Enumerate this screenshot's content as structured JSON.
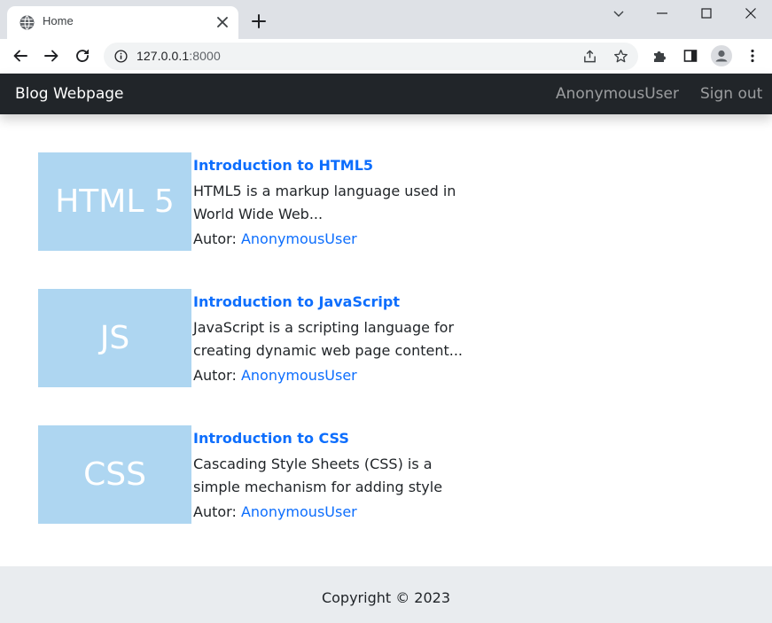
{
  "browser": {
    "tab_title": "Home",
    "url_host": "127.0.0.1",
    "url_port": ":8000"
  },
  "navbar": {
    "brand": "Blog Webpage",
    "user": "AnonymousUser",
    "sign_out": "Sign out"
  },
  "posts": [
    {
      "thumb_text": "HTML 5",
      "title": "Introduction to HTML5",
      "excerpt": "HTML5 is a markup language used in World Wide Web...",
      "author_label": "Autor:",
      "author": "AnonymousUser"
    },
    {
      "thumb_text": "JS",
      "title": "Introduction to JavaScript",
      "excerpt": "JavaScript is a scripting language for creating dynamic web page content...",
      "author_label": "Autor:",
      "author": "AnonymousUser"
    },
    {
      "thumb_text": "CSS",
      "title": "Introduction to CSS",
      "excerpt": "Cascading Style Sheets (CSS) is a simple mechanism for adding style",
      "author_label": "Autor:",
      "author": "AnonymousUser"
    }
  ],
  "footer": {
    "copyright": "Copyright © 2023"
  },
  "icons": {
    "tab_favicon": "globe-icon",
    "tab_close": "close-icon",
    "new_tab": "plus-icon",
    "back": "arrow-left-icon",
    "forward": "arrow-right-icon",
    "reload": "reload-icon",
    "site_info": "info-icon",
    "share": "share-icon",
    "bookmark": "star-icon",
    "extensions": "puzzle-icon",
    "side_panel": "side-panel-icon",
    "profile": "profile-icon",
    "menu": "kebab-menu-icon"
  },
  "colors": {
    "navbar_bg": "#212529",
    "link": "#0d6efd",
    "thumb_bg": "#aed6f1",
    "footer_bg": "#e9ecef"
  }
}
